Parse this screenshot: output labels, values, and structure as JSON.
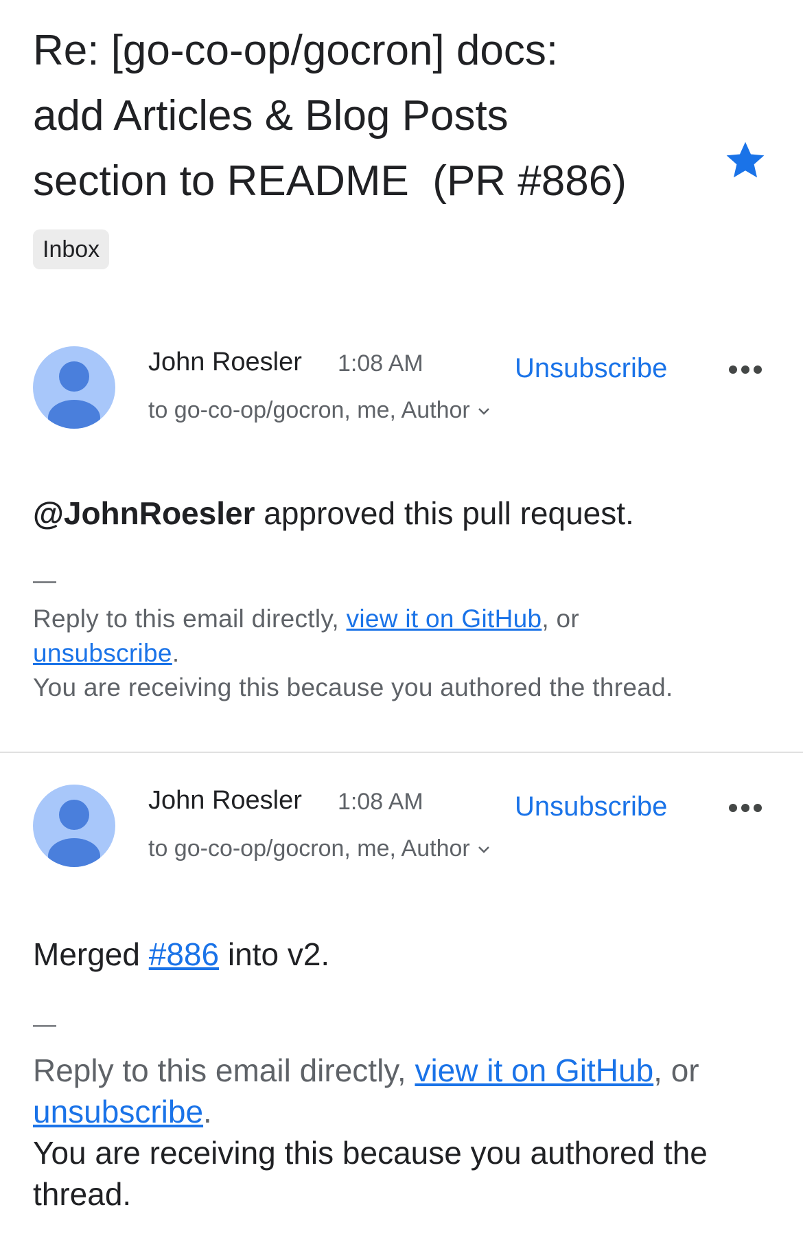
{
  "subject": {
    "lines": [
      "Re: [go-co-op/gocron] docs:",
      "add Articles & Blog Posts",
      "section to README  (PR #886)"
    ],
    "starred": true
  },
  "label": "Inbox",
  "colors": {
    "accent": "#1a73e8",
    "avatar_bg": "#a8c7fa",
    "avatar_fg": "#4a7fdc"
  },
  "messages": [
    {
      "sender": "John Roesler",
      "time": "1:08 AM",
      "unsubscribe": "Unsubscribe",
      "recipients": "to go-co-op/gocron, me, Author",
      "body": {
        "bold": "@JohnRoesler",
        "rest": " approved this pull request."
      },
      "dash": "—",
      "footer": {
        "t1": "Reply to this email directly, ",
        "link1": "view it on GitHub",
        "t2": ", or",
        "link2": "unsubscribe",
        "t3": ".",
        "t4": "You are receiving this because you authored the thread."
      }
    },
    {
      "sender": "John Roesler",
      "time": "1:08 AM",
      "unsubscribe": "Unsubscribe",
      "recipients": "to go-co-op/gocron, me, Author",
      "body": {
        "pre": "Merged ",
        "link": "#886",
        "post": " into v2."
      },
      "dash": "—",
      "footer": {
        "t1": "Reply to this email directly, ",
        "link1": "view it on GitHub",
        "t2": ", or",
        "link2": "unsubscribe",
        "t3": ".",
        "t4": "You are receiving this because you authored the thread."
      }
    }
  ],
  "icons": [
    "star-icon",
    "avatar-icon",
    "more-icon",
    "chevron-down-icon"
  ]
}
